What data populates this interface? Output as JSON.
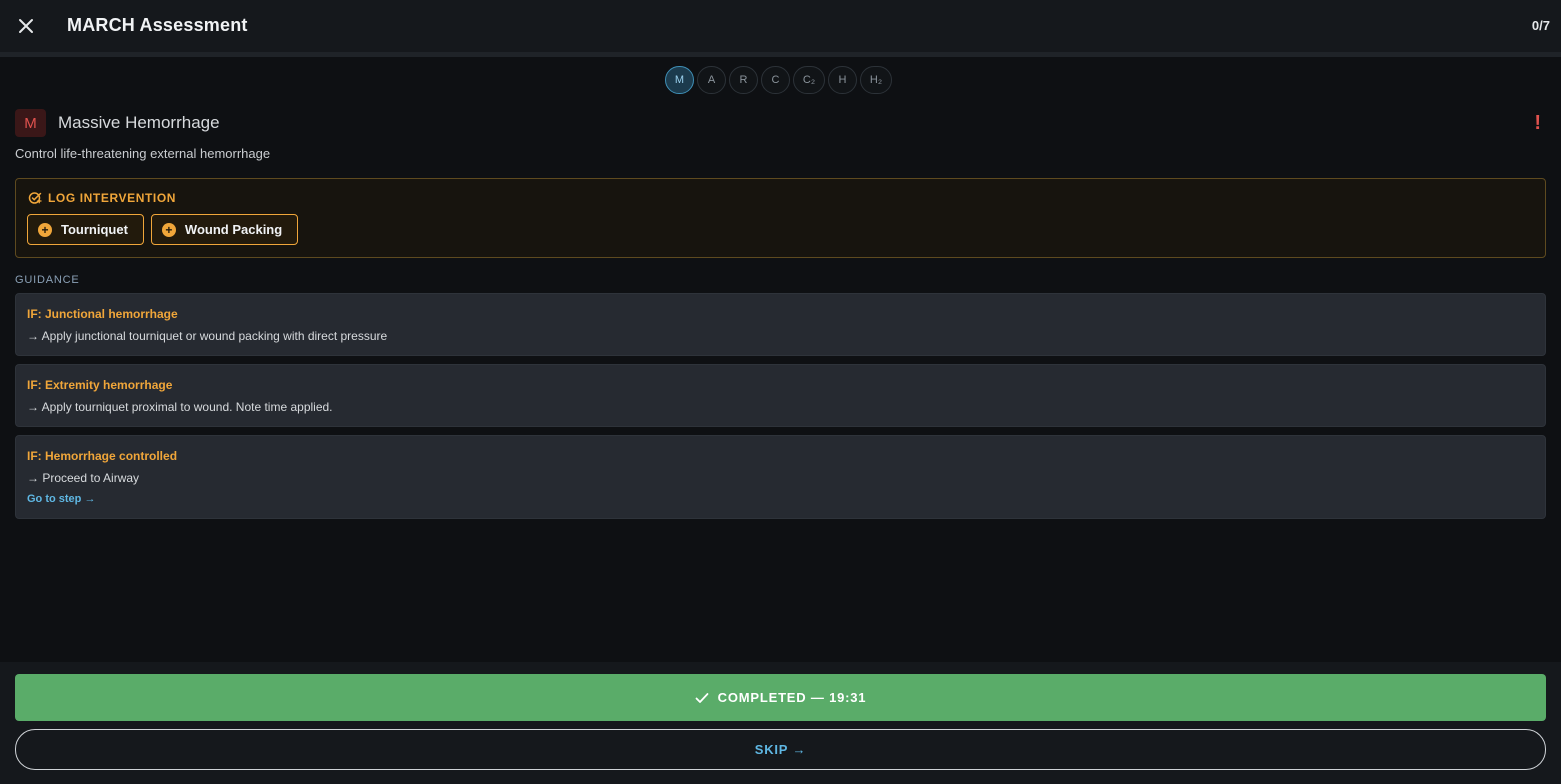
{
  "header": {
    "title": "MARCH Assessment",
    "progress": "0/7"
  },
  "steps": [
    {
      "label": "M",
      "active": true
    },
    {
      "label": "A"
    },
    {
      "label": "R"
    },
    {
      "label": "C"
    },
    {
      "label": "C₂"
    },
    {
      "label": "H"
    },
    {
      "label": "H₂"
    }
  ],
  "section": {
    "badge": "M",
    "title": "Massive Hemorrhage",
    "alert": "!",
    "description": "Control life-threatening external hemorrhage"
  },
  "intervention": {
    "label": "LOG INTERVENTION",
    "buttons": [
      {
        "label": "Tourniquet"
      },
      {
        "label": "Wound Packing"
      }
    ]
  },
  "guidance": {
    "label": "GUIDANCE",
    "items": [
      {
        "condition": "IF: Junctional hemorrhage",
        "action": "→ Apply junctional tourniquet or wound packing with direct pressure"
      },
      {
        "condition": "IF: Extremity hemorrhage",
        "action": "→ Apply tourniquet proximal to wound. Note time applied."
      },
      {
        "condition": "IF: Hemorrhage controlled",
        "action": "→ Proceed to Airway",
        "link": "Go to step →"
      }
    ]
  },
  "footer": {
    "complete_label": "COMPLETED — 19:31",
    "skip_label": "SKIP →"
  },
  "colors": {
    "accent_amber": "#f0a63a",
    "accent_blue": "#5fb7e3",
    "success_green": "#5aac69",
    "alert_red": "#e0524e"
  }
}
